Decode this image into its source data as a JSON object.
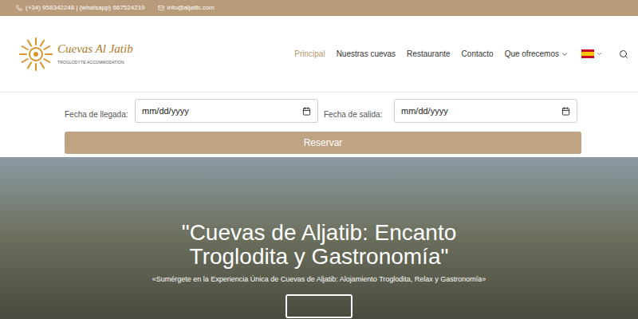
{
  "top_bar": {
    "phone": "(+34) 958342248 | (whatsapp) 667524219",
    "email": "info@aljatib.com"
  },
  "logo": {
    "name": "Cuevas Al Jatib",
    "tagline": "TROGLODYTE ACCOMMODATION"
  },
  "nav": [
    {
      "label": "Principal",
      "selected": true,
      "has_menu": false
    },
    {
      "label": "Nuestras cuevas",
      "selected": false,
      "has_menu": false
    },
    {
      "label": "Restaurante",
      "selected": false,
      "has_menu": false
    },
    {
      "label": "Contacto",
      "selected": false,
      "has_menu": false
    },
    {
      "label": "Que ofrecemos",
      "selected": false,
      "has_menu": true
    }
  ],
  "booking": {
    "fields": [
      {
        "label": "Fecha de llegada:",
        "placeholder": "mm/dd/yyyy"
      },
      {
        "label": "Fecha de salida:",
        "placeholder": "mm/dd/yyyy"
      }
    ],
    "button": "Reservar"
  },
  "hero": {
    "title": "\"Cuevas de Aljatib: Encanto Troglodita y Gastronomía\"",
    "subtitle": "«Sumérgete en la Experiencia Única de Cuevas de Aljatib: Alojamiento Troglodita, Relax y Gastronomía»"
  }
}
